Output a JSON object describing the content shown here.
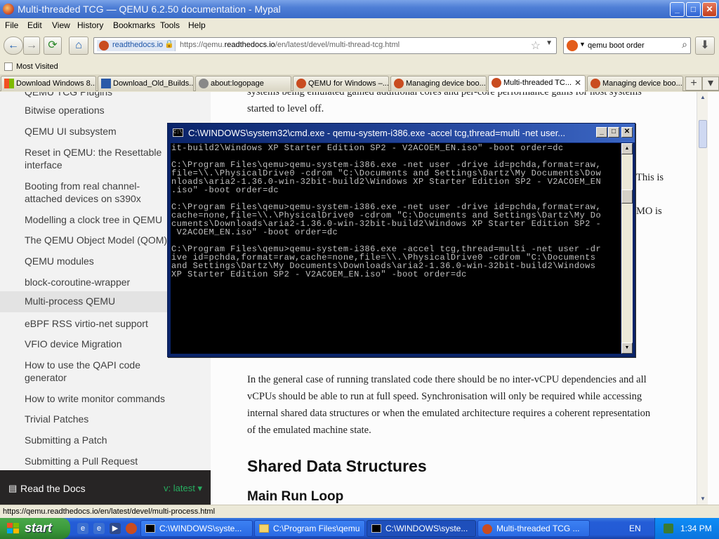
{
  "window": {
    "title": "Multi-threaded TCG — QEMU 6.2.50 documentation - Mypal",
    "minimize": "_",
    "maximize": "□",
    "close": "✕"
  },
  "menu": [
    "File",
    "Edit",
    "View",
    "History",
    "Bookmarks",
    "Tools",
    "Help"
  ],
  "nav": {
    "back": "←",
    "forward": "→",
    "reload": "⟳",
    "home": "⌂",
    "site_label": "readthedocs.io",
    "url_prefix": "https://qemu.",
    "url_domain": "readthedocs.io",
    "url_path": "/en/latest/devel/multi-thread-tcg.html",
    "star": "☆",
    "dropdown": "▼",
    "search_value": "qemu boot order",
    "search_icon": "⌕",
    "download": "⬇"
  },
  "bookmarks": {
    "most_visited": "Most Visited"
  },
  "tabs": [
    {
      "label": "Download Windows 8...",
      "icon_color": "#f25022"
    },
    {
      "label": "Download_Old_Builds...",
      "icon_color": "#2a5aa8"
    },
    {
      "label": "about:logopage",
      "icon_color": "#888888"
    },
    {
      "label": "QEMU for Windows –...",
      "icon_color": "#c94c20"
    },
    {
      "label": "Managing device boo...",
      "icon_color": "#c94c20"
    },
    {
      "label": "Multi-threaded TC...",
      "icon_color": "#c94c20",
      "active": true,
      "close": "✕"
    },
    {
      "label": "Managing device boo...",
      "icon_color": "#c94c20"
    }
  ],
  "tab_controls": {
    "new_tab": "+",
    "list": "▾"
  },
  "sidebar": {
    "cut_item": "QEMU TCG Plugins",
    "items": [
      "Bitwise operations",
      "QEMU UI subsystem",
      "Reset in QEMU: the Resettable interface",
      "Booting from real channel-attached devices on s390x",
      "Modelling a clock tree in QEMU",
      "The QEMU Object Model (QOM)",
      "QEMU modules",
      "block-coroutine-wrapper",
      "Multi-process QEMU",
      "eBPF RSS virtio-net support",
      "VFIO device Migration",
      "How to use the QAPI code generator",
      "How to write monitor commands",
      "Trivial Patches",
      "Submitting a Patch",
      "Submitting a Pull Request"
    ],
    "footer": {
      "label": "Read the Docs",
      "version": "v: latest ▾",
      "book_icon": "▤"
    }
  },
  "doc": {
    "top_line1": "systems being emulated gained additional cores and per-core performance gains for host systems",
    "top_line2": "started to level off.",
    "fragment1": "This is",
    "fragment2": "MO is",
    "para": [
      "In the general case of running translated code there should be no inter-vCPU dependencies and all",
      "vCPUs should be able to run at full speed. Synchronisation will only be required while accessing",
      "internal shared data structures or when the emulated architecture requires a coherent representation",
      "of the emulated machine state."
    ],
    "h_shared": "Shared Data Structures",
    "h_mainloop": "Main Run Loop"
  },
  "status": "https://qemu.readthedocs.io/en/latest/devel/multi-process.html",
  "cmd": {
    "title": "C:\\WINDOWS\\system32\\cmd.exe - qemu-system-i386.exe -accel tcg,thread=multi -net user...",
    "icon_text": "C:\\",
    "lines": [
      "it-build2\\Windows XP Starter Edition SP2 - V2ACOEM_EN.iso\" -boot order=dc",
      "",
      "C:\\Program Files\\qemu>qemu-system-i386.exe -net user -drive id=pchda,format=raw,",
      "file=\\\\.\\PhysicalDrive0 -cdrom \"C:\\Documents and Settings\\Dartz\\My Documents\\Dow",
      "nloads\\aria2-1.36.0-win-32bit-build2\\Windows XP Starter Edition SP2 - V2ACOEM_EN",
      ".iso\" -boot order=dc",
      "",
      "C:\\Program Files\\qemu>qemu-system-i386.exe -net user -drive id=pchda,format=raw,",
      "cache=none,file=\\\\.\\PhysicalDrive0 -cdrom \"C:\\Documents and Settings\\Dartz\\My Do",
      "cuments\\Downloads\\aria2-1.36.0-win-32bit-build2\\Windows XP Starter Edition SP2 -",
      " V2ACOEM_EN.iso\" -boot order=dc",
      "",
      "C:\\Program Files\\qemu>qemu-system-i386.exe -accel tcg,thread=multi -net user -dr",
      "ive id=pchda,format=raw,cache=none,file=\\\\.\\PhysicalDrive0 -cdrom \"C:\\Documents",
      "and Settings\\Dartz\\My Documents\\Downloads\\aria2-1.36.0-win-32bit-build2\\Windows",
      "XP Starter Edition SP2 - V2ACOEM_EN.iso\" -boot order=dc"
    ]
  },
  "taskbar": {
    "start": "start",
    "buttons": [
      {
        "label": "C:\\WINDOWS\\syste..."
      },
      {
        "label": "C:\\Program Files\\qemu"
      },
      {
        "label": "C:\\WINDOWS\\syste...",
        "active": true
      },
      {
        "label": "Multi-threaded TCG ..."
      }
    ],
    "lang": "EN",
    "clock": "1:34 PM"
  }
}
